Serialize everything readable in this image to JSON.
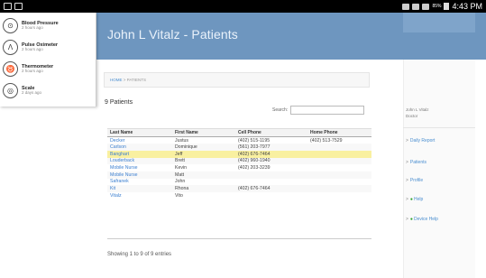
{
  "status_bar": {
    "time": "4:43 PM",
    "battery": "85%"
  },
  "app": {
    "title": "John L Vitalz - Patients"
  },
  "notifications": [
    {
      "icon": "blood-pressure-icon",
      "glyph": "⊙",
      "title": "Blood Pressure",
      "time": "2 hours ago"
    },
    {
      "icon": "pulse-oximeter-icon",
      "glyph": "Λ",
      "title": "Pulse Oximeter",
      "time": "2 hours ago"
    },
    {
      "icon": "thermometer-icon",
      "glyph": "♉",
      "title": "Thermometer",
      "time": "2 hours ago"
    },
    {
      "icon": "scale-icon",
      "glyph": "◎",
      "title": "Scale",
      "time": "2 days ago"
    }
  ],
  "breadcrumb": {
    "home": "HOME",
    "separator": ">",
    "current": "PATIENTS"
  },
  "patients": {
    "count_title": "9 Patients",
    "search_label": "Search:",
    "search_value": "",
    "columns": [
      "Last Name",
      "First Name",
      "Cell Phone",
      "Home Phone"
    ],
    "rows": [
      {
        "last": "Decker",
        "first": "Justus",
        "cell": "(402) 515-1195",
        "home": "(402) 513-7529",
        "highlight": false
      },
      {
        "last": "Carlson",
        "first": "Dominique",
        "cell": "(561) 203-7977",
        "home": "",
        "highlight": false
      },
      {
        "last": "Banghart",
        "first": "Jeff",
        "cell": "(402) 676-7464",
        "home": "",
        "highlight": true
      },
      {
        "last": "Louderback",
        "first": "Brett",
        "cell": "(402) 960-1940",
        "home": "",
        "highlight": false
      },
      {
        "last": "Mobile Nurse",
        "first": "Kevin",
        "cell": "(402) 203-3239",
        "home": "",
        "highlight": false
      },
      {
        "last": "Mobile Nurse",
        "first": "Matt",
        "cell": "",
        "home": "",
        "highlight": false
      },
      {
        "last": "Safranek",
        "first": "John",
        "cell": "",
        "home": "",
        "highlight": false
      },
      {
        "last": "Kit",
        "first": "Rhona",
        "cell": "(402) 676-7464",
        "home": "",
        "highlight": false
      },
      {
        "last": "Vitalz",
        "first": "Vito",
        "cell": "",
        "home": "",
        "highlight": false
      }
    ],
    "entries_info": "Showing 1 to 9 of 9 entries"
  },
  "sidebar": {
    "user_name": "John L Vitalz",
    "user_role": "Doctor",
    "links": [
      {
        "label": "Daily Report",
        "prefix": ">",
        "dot": false
      },
      {
        "label": "Patients",
        "prefix": ">",
        "dot": false
      },
      {
        "label": "Profile",
        "prefix": ">",
        "dot": false
      },
      {
        "label": "Help",
        "prefix": ">",
        "dot": true
      },
      {
        "label": "Device Help",
        "prefix": ">",
        "dot": true
      }
    ]
  },
  "colors": {
    "header": "#6e96bf",
    "link": "#3b7fd0",
    "highlight_row": "#f9f0a0"
  }
}
